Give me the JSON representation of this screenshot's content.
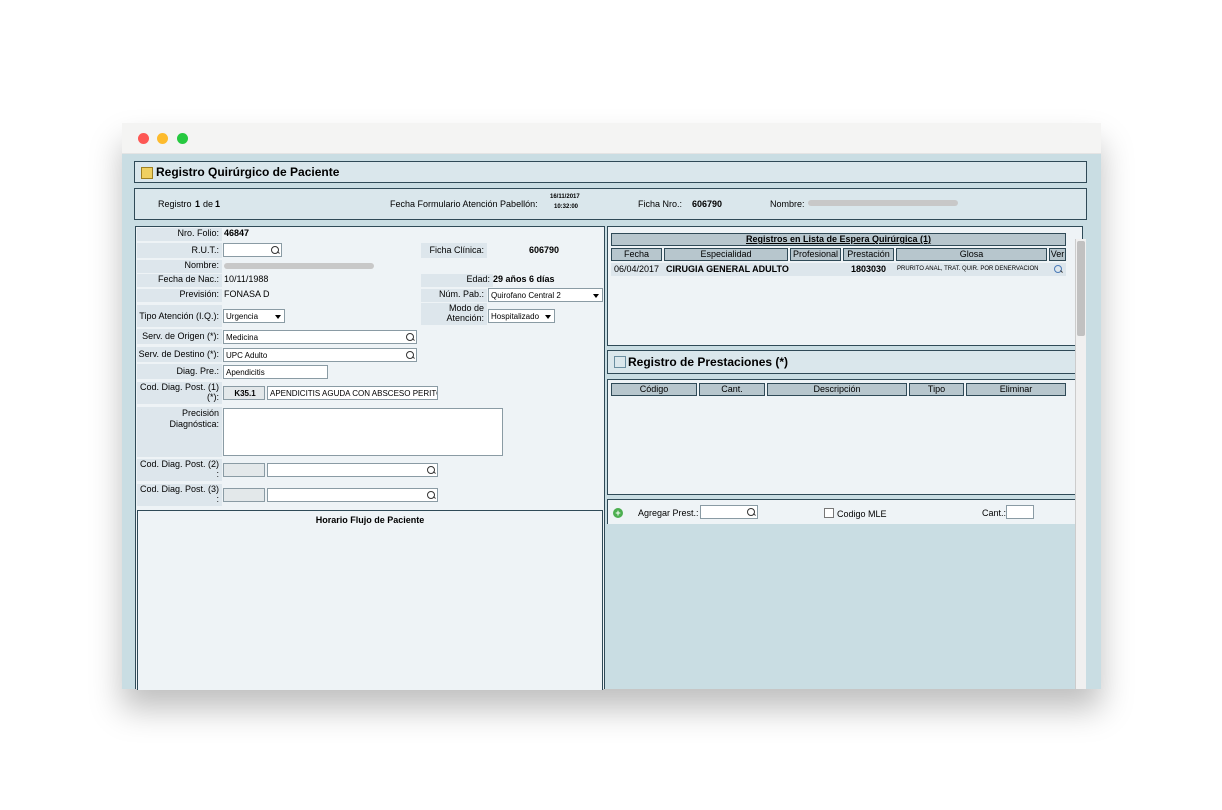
{
  "page_title": "Registro Quirúrgico de Paciente",
  "info": {
    "registro_label": "Registro",
    "registro_num": "1",
    "de_label": "de",
    "registro_total": "1",
    "fecha_label": "Fecha Formulario Atención Pabellón:",
    "fecha_date": "16/11/2017",
    "fecha_time": "10:32:00",
    "ficha_label": "Ficha Nro.:",
    "ficha_value": "606790",
    "nombre_label": "Nombre:"
  },
  "form": {
    "folio_label": "Nro. Folio:",
    "folio_value": "46847",
    "rut_label": "R.U.T.:",
    "ficha_clinica_label": "Ficha Clínica:",
    "ficha_clinica_value": "606790",
    "nombre_label": "Nombre:",
    "fecha_nac_label": "Fecha de Nac.:",
    "fecha_nac_value": "10/11/1988",
    "edad_label": "Edad:",
    "edad_value": "29 años 6 días",
    "prevision_label": "Previsión:",
    "prevision_value": "FONASA D",
    "num_pab_label": "Núm. Pab.:",
    "num_pab_value": "Quirofano Central 2",
    "tipo_atencion_label": "Tipo Atención (I.Q.):",
    "tipo_atencion_value": "Urgencia",
    "modo_label_1": "Modo de",
    "modo_label_2": "Atención:",
    "modo_value": "Hospitalizado",
    "serv_origen_label": "Serv. de Origen (*):",
    "serv_origen_value": "Medicina",
    "serv_destino_label": "Serv. de Destino (*):",
    "serv_destino_value": "UPC Adulto",
    "diag_pre_label": "Diag. Pre.:",
    "diag_pre_value": "Apendicitis",
    "cod_diag1_label_1": "Cod. Diag. Post. (1)",
    "cod_diag1_label_2": "(*):",
    "cod_diag1_code": "K35.1",
    "cod_diag1_desc": "APENDICITIS AGUDA CON ABSCESO PERITON",
    "precision_label_1": "Precisión",
    "precision_label_2": "Diagnóstica:",
    "cod_diag2_label_1": "Cod. Diag. Post. (2)",
    "cod_diag2_label_2": ":",
    "cod_diag3_label_1": "Cod. Diag. Post. (3)",
    "cod_diag3_label_2": ":",
    "horario_title": "Horario Flujo de Paciente"
  },
  "espera": {
    "title": "Registros en Lista de Espera Quirúrgica (1)",
    "headers": [
      "Fecha",
      "Especialidad",
      "Profesional",
      "Prestación",
      "Glosa",
      "Ver"
    ],
    "row": {
      "fecha": "06/04/2017",
      "especialidad": "CIRUGIA GENERAL ADULTO",
      "profesional": "",
      "prestacion": "1803030",
      "glosa": "PRURITO ANAL, TRAT. QUIR. POR DENERVACION"
    }
  },
  "prestaciones": {
    "title": "Registro de Prestaciones (*)",
    "headers": [
      "Código",
      "Cant.",
      "Descripción",
      "Tipo",
      "Eliminar"
    ],
    "agregar_label": "Agregar Prest.:",
    "codigo_mle_label": "Codigo MLE",
    "cant_label": "Cant.:"
  }
}
